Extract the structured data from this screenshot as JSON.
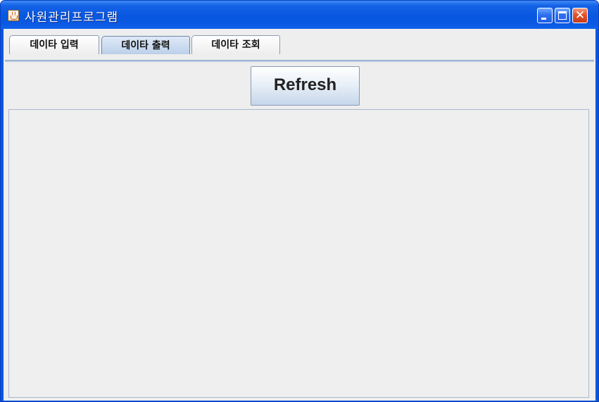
{
  "window": {
    "title": "사원관리프로그램",
    "icons": {
      "app": "java-cup-icon",
      "minimize": "minimize-icon",
      "maximize": "maximize-icon",
      "close": "close-icon"
    },
    "close_glyph": "✕"
  },
  "tabs": [
    {
      "label": "데이타 입력",
      "selected": false
    },
    {
      "label": "데이타 출력",
      "selected": true
    },
    {
      "label": "데이타 조회",
      "selected": false
    }
  ],
  "panel": {
    "refresh_label": "Refresh",
    "output_text": ""
  },
  "colors": {
    "titlebar": "#0a56e0",
    "panel_background": "#eeeeee",
    "selected_tab": "#bcd0ea"
  }
}
